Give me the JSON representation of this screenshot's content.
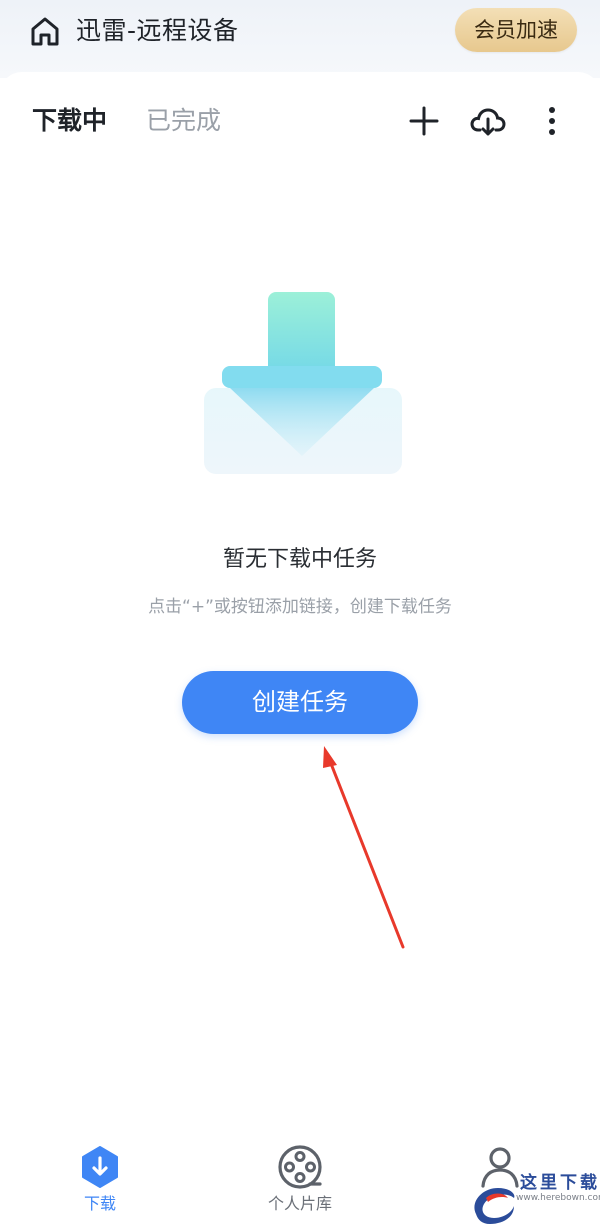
{
  "header": {
    "title": "迅雷-远程设备",
    "vip_label": "会员加速"
  },
  "tabs": [
    {
      "label": "下载中",
      "active": true
    },
    {
      "label": "已完成",
      "active": false
    }
  ],
  "toolbar": {
    "icons": [
      "add-icon",
      "cloud-download-icon",
      "more-icon"
    ]
  },
  "empty_state": {
    "title": "暂无下载中任务",
    "subtitle": "点击“+”或按钮添加链接，创建下载任务",
    "button_label": "创建任务"
  },
  "bottom_nav": {
    "items": [
      {
        "label": "下载",
        "icon": "download-icon",
        "active": true
      },
      {
        "label": "个人片库",
        "icon": "film-reel-icon",
        "active": false
      },
      {
        "label": "",
        "icon": "profile-icon",
        "active": false
      }
    ]
  },
  "watermark": {
    "text": "这里下载",
    "url": "www.herebown.com"
  },
  "colors": {
    "accent": "#3f86f5",
    "vip_gold": "#e7c88e",
    "annotation_red": "#e8392b"
  }
}
